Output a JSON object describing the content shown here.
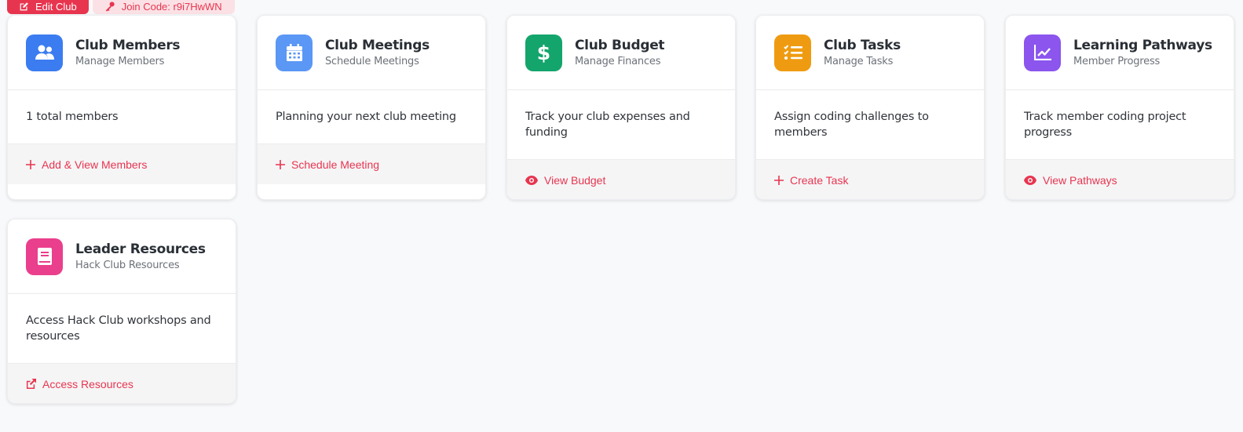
{
  "top_actions": {
    "edit_label": "Edit Club",
    "join_label": "Join Code:  r9i7HwWN"
  },
  "colors": {
    "accent": "#e8354f",
    "members_icon_bg": "#3b7cf0",
    "meetings_icon_bg": "#5b97f5",
    "budget_icon_bg": "#14a56c",
    "tasks_icon_bg": "#ef9b12",
    "pathways_icon_bg": "#8b55ee",
    "resources_icon_bg": "#ea3f8c"
  },
  "cards": [
    {
      "title": "Club Members",
      "subtitle": "Manage Members",
      "icon": "users-icon",
      "body": "1 total members",
      "action": "Add & View Members",
      "action_icon": "plus-icon"
    },
    {
      "title": "Club Meetings",
      "subtitle": "Schedule Meetings",
      "icon": "calendar-icon",
      "body": "Planning your next club meeting",
      "action": "Schedule Meeting",
      "action_icon": "plus-icon"
    },
    {
      "title": "Club Budget",
      "subtitle": "Manage Finances",
      "icon": "dollar-icon",
      "body": "Track your club expenses and funding",
      "action": "View Budget",
      "action_icon": "eye-icon"
    },
    {
      "title": "Club Tasks",
      "subtitle": "Manage Tasks",
      "icon": "task-list-icon",
      "body": "Assign coding challenges to members",
      "action": "Create Task",
      "action_icon": "plus-icon"
    },
    {
      "title": "Learning Pathways",
      "subtitle": "Member Progress",
      "icon": "chart-line-icon",
      "body": "Track member coding project progress",
      "action": "View Pathways",
      "action_icon": "eye-icon"
    },
    {
      "title": "Leader Resources",
      "subtitle": "Hack Club Resources",
      "icon": "book-icon",
      "body": "Access Hack Club workshops and resources",
      "action": "Access Resources",
      "action_icon": "external-link-icon"
    }
  ]
}
